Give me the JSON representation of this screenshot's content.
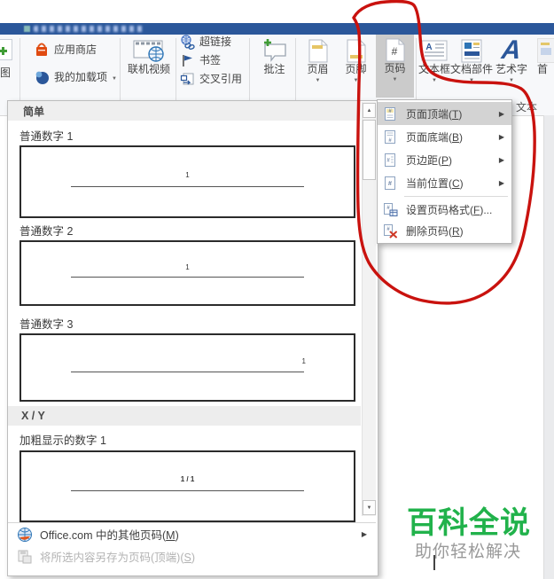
{
  "ribbon": {
    "partial_button_label": "图",
    "store_button": "应用商店",
    "addins_button": "我的加载项",
    "video_button": "联机视频",
    "hyperlink_button": "超链接",
    "bookmark_button": "书签",
    "crossref_button": "交叉引用",
    "comment_button": "批注",
    "header_button": "页眉",
    "footer_button": "页脚",
    "pagenum_button": "页码",
    "pagenum_symbol": "#",
    "textbox_button": "文本框",
    "quickparts_button": "文档部件",
    "wordart_button": "艺术字",
    "dropcap_partial": "首",
    "text_group_label": "文本"
  },
  "gallery": {
    "section_simple": "简单",
    "items": [
      {
        "label": "普通数字 1",
        "number": "1"
      },
      {
        "label": "普通数字 2",
        "number": "1"
      },
      {
        "label": "普通数字 3",
        "number": "1"
      }
    ],
    "section_xy": "X / Y",
    "bold_item": {
      "label": "加粗显示的数字 1",
      "number": "1 / 1"
    },
    "footer": {
      "office_pre": "Office.com 中的其他页码(",
      "office_key": "M",
      "office_post": ")",
      "save_pre": "将所选内容另存为页码(顶端)(",
      "save_key": "S",
      "save_post": ")"
    }
  },
  "menu": {
    "items": [
      {
        "pre": "页面顶端(",
        "key": "T",
        "post": ")"
      },
      {
        "pre": "页面底端(",
        "key": "B",
        "post": ")"
      },
      {
        "pre": "页边距(",
        "key": "P",
        "post": ")"
      },
      {
        "pre": "当前位置(",
        "key": "C",
        "post": ")"
      },
      {
        "pre": "设置页码格式(",
        "key": "F",
        "post": ")..."
      },
      {
        "pre": "删除页码(",
        "key": "R",
        "post": ")"
      }
    ]
  },
  "watermark": {
    "title": "百科全说",
    "subtitle": "助你轻松解决"
  },
  "glyphs": {
    "scroll_up": "▲",
    "scroll_down": "▼",
    "submenu_arrow": "▶",
    "dropdown_caret": "▼"
  },
  "colors": {
    "titlebar": "#2b579a",
    "annotation": "#c9120e",
    "green": "#21b24b",
    "highlight": "#cbcbcb"
  }
}
